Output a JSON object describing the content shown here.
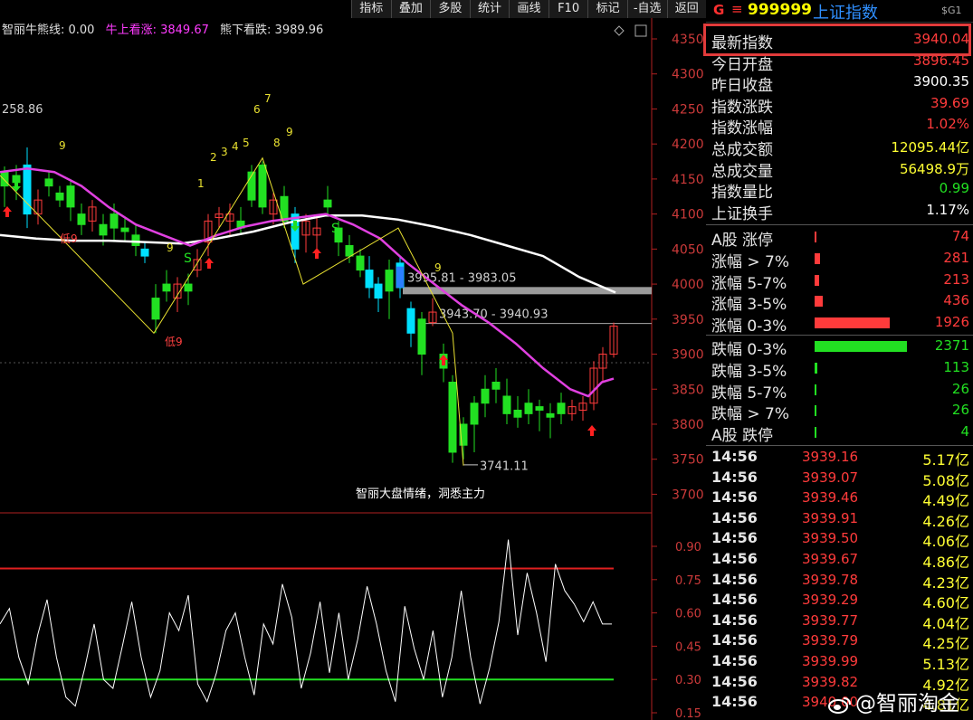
{
  "toolbar": [
    "指标",
    "叠加",
    "多股",
    "统计",
    "画线",
    "F10",
    "标记",
    "-自选",
    "返回"
  ],
  "legend": {
    "name": "智丽牛熊线: 0.00",
    "bull": "牛上看涨: 3849.67",
    "bear": "熊下看跌: 3989.96"
  },
  "chart_labels": {
    "left_price": "258.86",
    "high_range": "3995.81 - 3983.05",
    "mid_range": "3943.70 - 3940.93",
    "low_price": "3741.11",
    "caption": "智丽大盘情绪，洞悉主力",
    "low9_a": "低9",
    "low9_b": "低9",
    "seq_numbers": [
      "9",
      "1",
      "2",
      "3",
      "4",
      "5",
      "6",
      "7",
      "8",
      "9",
      "9",
      "9",
      "9"
    ],
    "buy_s": "S"
  },
  "price_axis": [
    "4350",
    "4300",
    "4250",
    "4200",
    "4150",
    "4100",
    "4050",
    "4000",
    "3950",
    "3900",
    "3850",
    "3800",
    "3750",
    "3700"
  ],
  "osc_axis": [
    "0.90",
    "0.75",
    "0.60",
    "0.45",
    "0.30",
    "0.15"
  ],
  "header": {
    "g": "G",
    "menu": "≡",
    "code": "999999",
    "name": "上证指数",
    "sg": "$G1"
  },
  "quote": [
    {
      "k": "最新指数",
      "v": "3940.04",
      "c": "up"
    },
    {
      "k": "今日开盘",
      "v": "3896.45",
      "c": "up"
    },
    {
      "k": "昨日收盘",
      "v": "3900.35",
      "c": "wh"
    },
    {
      "k": "指数涨跌",
      "v": "39.69",
      "c": "up"
    },
    {
      "k": "指数涨幅",
      "v": "1.02%",
      "c": "up"
    },
    {
      "k": "总成交额",
      "v": "12095.44亿",
      "c": "yl"
    },
    {
      "k": "总成交量",
      "v": "56498.9万",
      "c": "yl"
    },
    {
      "k": "指数量比",
      "v": "0.99",
      "c": "dn"
    },
    {
      "k": "上证换手",
      "v": "1.17%",
      "c": "wh"
    }
  ],
  "breadth_up": [
    {
      "k": "A股 涨停",
      "v": "74",
      "frac": 0.015
    },
    {
      "k": "涨幅 > 7%",
      "v": "281",
      "frac": 0.06
    },
    {
      "k": "涨幅 5-7%",
      "v": "213",
      "frac": 0.045
    },
    {
      "k": "涨幅 3-5%",
      "v": "436",
      "frac": 0.09
    },
    {
      "k": "涨幅 0-3%",
      "v": "1926",
      "frac": 0.81
    }
  ],
  "breadth_dn": [
    {
      "k": "跌幅 0-3%",
      "v": "2371",
      "frac": 1.0
    },
    {
      "k": "跌幅 3-5%",
      "v": "113",
      "frac": 0.025
    },
    {
      "k": "跌幅 5-7%",
      "v": "26",
      "frac": 0.006
    },
    {
      "k": "跌幅 > 7%",
      "v": "26",
      "frac": 0.006
    },
    {
      "k": "A股 跌停",
      "v": "4",
      "frac": 0.003
    }
  ],
  "ticks": [
    {
      "t": "14:56",
      "p": "3939.16",
      "a": "5.17亿"
    },
    {
      "t": "14:56",
      "p": "3939.07",
      "a": "5.08亿"
    },
    {
      "t": "14:56",
      "p": "3939.46",
      "a": "4.49亿"
    },
    {
      "t": "14:56",
      "p": "3939.91",
      "a": "4.26亿"
    },
    {
      "t": "14:56",
      "p": "3939.50",
      "a": "4.06亿"
    },
    {
      "t": "14:56",
      "p": "3939.67",
      "a": "4.86亿"
    },
    {
      "t": "14:56",
      "p": "3939.78",
      "a": "4.23亿"
    },
    {
      "t": "14:56",
      "p": "3939.29",
      "a": "4.60亿"
    },
    {
      "t": "14:56",
      "p": "3939.77",
      "a": "4.04亿"
    },
    {
      "t": "14:56",
      "p": "3939.79",
      "a": "4.25亿"
    },
    {
      "t": "14:56",
      "p": "3939.99",
      "a": "5.13亿"
    },
    {
      "t": "14:56",
      "p": "3939.82",
      "a": "4.92亿"
    },
    {
      "t": "14:56",
      "p": "3940.00",
      "a": "4.81亿"
    }
  ],
  "watermark": "@智丽淘金",
  "colors": {
    "up": "#ff3b3b",
    "down": "#22e022",
    "ma_pink": "#e040e0",
    "ma_white": "#ffffff",
    "accent_red": "#e23b3b",
    "yellow": "#ffff33"
  }
}
